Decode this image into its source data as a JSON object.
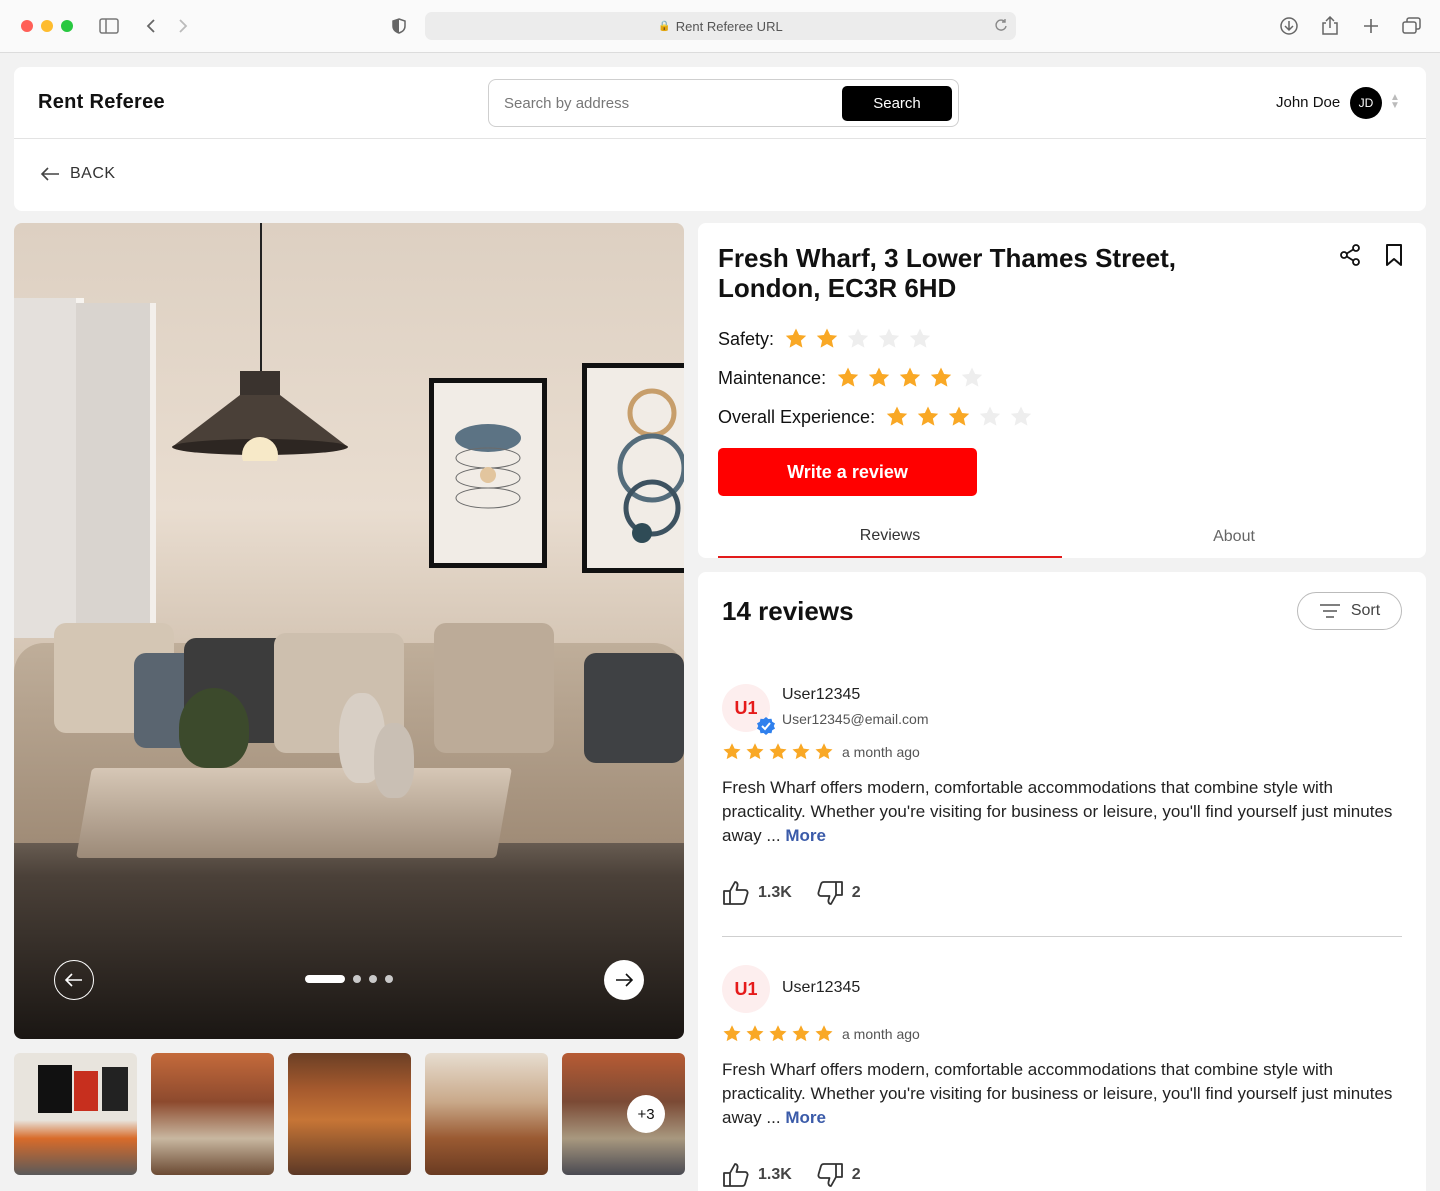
{
  "browser": {
    "url_text": "Rent Referee URL"
  },
  "header": {
    "brand": "Rent Referee",
    "search_placeholder": "Search by address",
    "search_button": "Search",
    "user_name": "John Doe",
    "user_initials": "JD",
    "back_label": "BACK"
  },
  "gallery": {
    "slide_count": 4,
    "active_slide": 1,
    "more_photos": "+3"
  },
  "property": {
    "title_line1": "Fresh Wharf, 3 Lower Thames Street,",
    "title_line2": "London, EC3R 6HD",
    "ratings": [
      {
        "label": "Safety:",
        "value": 2,
        "max": 5
      },
      {
        "label": "Maintenance:",
        "value": 4,
        "max": 5
      },
      {
        "label": "Overall Experience:",
        "value": 3,
        "max": 5
      }
    ],
    "write_review": "Write a review",
    "tabs": [
      "Reviews",
      "About"
    ],
    "active_tab": "Reviews"
  },
  "reviews": {
    "count_label": "14 reviews",
    "sort_label": "Sort",
    "items": [
      {
        "initials": "U1",
        "name": "User12345",
        "email": "User12345@email.com",
        "verified": true,
        "stars": 5,
        "time": "a month ago",
        "text": "Fresh Wharf offers modern, comfortable accommodations that combine style with practicality. Whether you're visiting for business or leisure, you'll find yourself just minutes away ...",
        "more": "More",
        "likes": "1.3K",
        "dislikes": "2"
      },
      {
        "initials": "U1",
        "name": "User12345",
        "stars": 5,
        "time": "a month ago",
        "text": "Fresh Wharf offers modern, comfortable accommodations that combine style with practicality. Whether you're visiting for business or leisure, you'll find yourself just minutes away ...",
        "more": "More",
        "likes": "1.3K",
        "dislikes": "2"
      }
    ]
  },
  "colors": {
    "accent_red": "#ff0000",
    "star_filled": "#f9a825",
    "star_empty": "#eeeeee",
    "link_blue": "#3b5ba9",
    "verified_blue": "#2f80ed"
  }
}
